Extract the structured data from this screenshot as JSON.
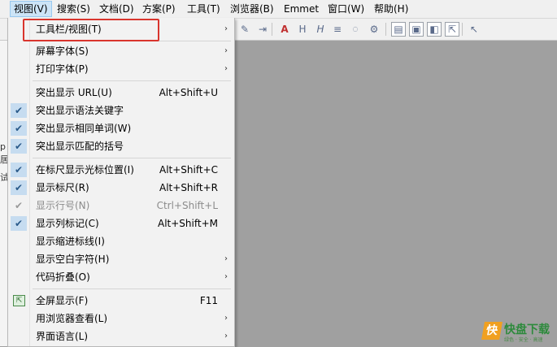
{
  "menubar": {
    "items": [
      {
        "label": "视图(V)"
      },
      {
        "label": "搜索(S)"
      },
      {
        "label": "文档(D)"
      },
      {
        "label": "方案(P)"
      },
      {
        "label": "工具(T)"
      },
      {
        "label": "浏览器(B)"
      },
      {
        "label": "Emmet"
      },
      {
        "label": "窗口(W)"
      },
      {
        "label": "帮助(H)"
      }
    ]
  },
  "toolbar": {
    "icons": [
      "paint-icon",
      "insert-column-icon",
      "font-a-icon",
      "heading-hx-icon",
      "italic-h-icon",
      "align-icon",
      "abc-spellcheck-icon",
      "gear-icon",
      "page-icon",
      "layout-icon",
      "browser-icon",
      "fullscreen-icon",
      "help-cursor-icon"
    ]
  },
  "left_strip": {
    "chars": [
      "p",
      "居",
      "试"
    ]
  },
  "view_menu": {
    "items": [
      {
        "label": "工具栏/视图(T)",
        "shortcut": "",
        "submenu": true,
        "checked": false,
        "disabled": false
      },
      {
        "label": "屏幕字体(S)",
        "shortcut": "",
        "submenu": true,
        "checked": false,
        "disabled": false
      },
      {
        "label": "打印字体(P)",
        "shortcut": "",
        "submenu": true,
        "checked": false,
        "disabled": false
      },
      {
        "label": "突出显示 URL(U)",
        "shortcut": "Alt+Shift+U",
        "submenu": false,
        "checked": false,
        "disabled": false
      },
      {
        "label": "突出显示语法关键字",
        "shortcut": "",
        "submenu": false,
        "checked": true,
        "disabled": false
      },
      {
        "label": "突出显示相同单词(W)",
        "shortcut": "",
        "submenu": false,
        "checked": true,
        "disabled": false
      },
      {
        "label": "突出显示匹配的括号",
        "shortcut": "",
        "submenu": false,
        "checked": true,
        "disabled": false
      },
      {
        "label": "在标尺显示光标位置(I)",
        "shortcut": "Alt+Shift+C",
        "submenu": false,
        "checked": true,
        "disabled": false
      },
      {
        "label": "显示标尺(R)",
        "shortcut": "Alt+Shift+R",
        "submenu": false,
        "checked": true,
        "disabled": false
      },
      {
        "label": "显示行号(N)",
        "shortcut": "Ctrl+Shift+L",
        "submenu": false,
        "checked": true,
        "disabled": true
      },
      {
        "label": "显示列标记(C)",
        "shortcut": "Alt+Shift+M",
        "submenu": false,
        "checked": true,
        "disabled": false
      },
      {
        "label": "显示缩进标线(I)",
        "shortcut": "",
        "submenu": false,
        "checked": false,
        "disabled": false
      },
      {
        "label": "显示空白字符(H)",
        "shortcut": "",
        "submenu": true,
        "checked": false,
        "disabled": false
      },
      {
        "label": "代码折叠(O)",
        "shortcut": "",
        "submenu": true,
        "checked": false,
        "disabled": false
      },
      {
        "label": "全屏显示(F)",
        "shortcut": "F11",
        "submenu": false,
        "checked": false,
        "disabled": false
      },
      {
        "label": "用浏览器查看(L)",
        "shortcut": "",
        "submenu": true,
        "checked": false,
        "disabled": false
      },
      {
        "label": "界面语言(L)",
        "shortcut": "",
        "submenu": true,
        "checked": false,
        "disabled": false
      }
    ],
    "submenu_arrow": "›",
    "check_mark": "✔"
  },
  "watermark": {
    "mark": "快",
    "name": "快盘下载",
    "tagline": "绿色 · 安全 · 高速"
  },
  "colors": {
    "highlight_border": "#d9352d",
    "check_bg": "#c6dcf0",
    "editor_bg": "#a0a0a0"
  }
}
